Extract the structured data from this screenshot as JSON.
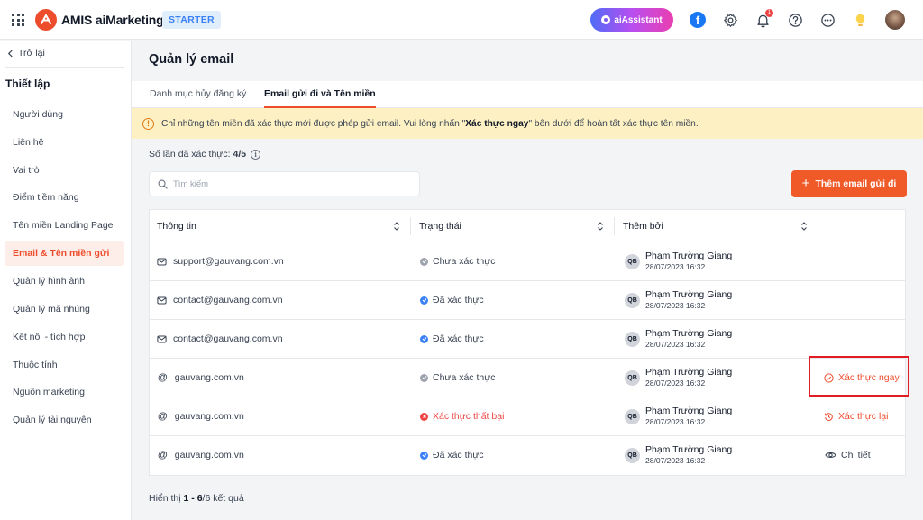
{
  "app": {
    "name": "AMIS aiMarketing",
    "plan": "STARTER",
    "assistant_label": "aiAssistant",
    "notification_count": "1",
    "brand_color": "#ee4d2d"
  },
  "sidebar": {
    "back_label": "Trở lại",
    "title": "Thiết lập",
    "items": [
      {
        "label": "Người dùng"
      },
      {
        "label": "Liên hệ"
      },
      {
        "label": "Vai trò"
      },
      {
        "label": "Điểm tiềm năng"
      },
      {
        "label": "Tên miền Landing Page"
      },
      {
        "label": "Email & Tên miền gửi",
        "active": true
      },
      {
        "label": "Quản lý hình ảnh"
      },
      {
        "label": "Quản lý mã nhúng"
      },
      {
        "label": "Kết nối - tích hợp"
      },
      {
        "label": "Thuộc tính"
      },
      {
        "label": "Nguồn marketing"
      },
      {
        "label": "Quản lý tài nguyên"
      }
    ]
  },
  "main": {
    "title": "Quản lý email",
    "tabs": [
      {
        "label": "Danh mục hủy đăng ký"
      },
      {
        "label": "Email gửi đi và Tên miền",
        "active": true
      }
    ],
    "alert": {
      "prefix": "Chỉ những tên miền đã xác thực mới được phép gửi email. Vui lòng nhấn \"",
      "emphasis": "Xác thực ngay",
      "suffix": "\" bên dưới để hoàn tất xác thực tên miền."
    },
    "verify_count_label": "Số lần đã xác thực:",
    "verify_count_value": "4/5",
    "search_placeholder": "Tìm kiếm",
    "add_button_label": "Thêm email gửi đi",
    "table": {
      "columns": [
        "Thông tin",
        "Trạng thái",
        "Thêm bởi"
      ],
      "rows": [
        {
          "type": "email",
          "info": "support@gauvang.com.vn",
          "status": "Chưa xác thực",
          "status_kind": "gray",
          "user_initials": "QB",
          "user_name": "Phạm Trường Giang",
          "date": "28/07/2023 16:32",
          "action": ""
        },
        {
          "type": "email",
          "info": "contact@gauvang.com.vn",
          "status": "Đã xác thực",
          "status_kind": "blue",
          "user_initials": "QB",
          "user_name": "Phạm Trường Giang",
          "date": "28/07/2023 16:32",
          "action": ""
        },
        {
          "type": "email",
          "info": "contact@gauvang.com.vn",
          "status": "Đã xác thực",
          "status_kind": "blue",
          "user_initials": "QB",
          "user_name": "Phạm Trường Giang",
          "date": "28/07/2023 16:32",
          "action": ""
        },
        {
          "type": "domain",
          "info": "gauvang.com.vn",
          "status": "Chưa xác thực",
          "status_kind": "gray",
          "user_initials": "QB",
          "user_name": "Phạm Trường Giang",
          "date": "28/07/2023 16:32",
          "action": "Xác thực ngay",
          "action_kind": "verify"
        },
        {
          "type": "domain",
          "info": "gauvang.com.vn",
          "status": "Xác thực thất bại",
          "status_kind": "red",
          "user_initials": "QB",
          "user_name": "Phạm Trường Giang",
          "date": "28/07/2023 16:32",
          "action": "Xác thực lại",
          "action_kind": "retry"
        },
        {
          "type": "domain",
          "info": "gauvang.com.vn",
          "status": "Đã xác thực",
          "status_kind": "blue",
          "user_initials": "QB",
          "user_name": "Phạm Trường Giang",
          "date": "28/07/2023 16:32",
          "action": "Chi tiết",
          "action_kind": "details"
        }
      ]
    },
    "footer": {
      "prefix": "Hiển thị",
      "range": "1 - 6",
      "suffix": "/6 kết quả"
    }
  }
}
